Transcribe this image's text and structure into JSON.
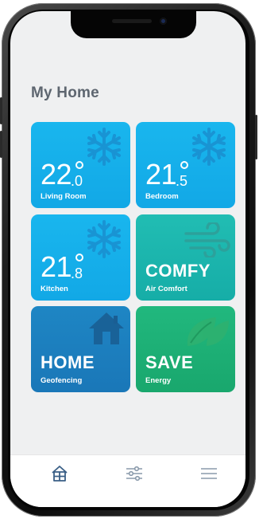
{
  "page": {
    "title": "My Home"
  },
  "tiles": [
    {
      "kind": "temperature",
      "whole": "22",
      "decimal": ".0",
      "label": "Living Room",
      "icon": "snowflake-icon",
      "color": "#19b6ee"
    },
    {
      "kind": "temperature",
      "whole": "21",
      "decimal": ".5",
      "label": "Bedroom",
      "icon": "snowflake-icon",
      "color": "#19b6ee"
    },
    {
      "kind": "temperature",
      "whole": "21",
      "decimal": ".8",
      "label": "Kitchen",
      "icon": "snowflake-icon",
      "color": "#19b6ee"
    },
    {
      "kind": "mode",
      "word": "COMFY",
      "label": "Air Comfort",
      "icon": "wind-icon",
      "color": "#21bdb3"
    },
    {
      "kind": "mode",
      "word": "HOME",
      "label": "Geofencing",
      "icon": "house-icon",
      "color": "#1e86c4"
    },
    {
      "kind": "mode",
      "word": "SAVE",
      "label": "Energy",
      "icon": "leaf-icon",
      "color": "#21b87e"
    }
  ],
  "tabbar": {
    "items": [
      {
        "icon": "home-icon",
        "active": true,
        "color": "#3a5f86"
      },
      {
        "icon": "sliders-icon",
        "active": false,
        "color": "#8a9aab"
      },
      {
        "icon": "menu-icon",
        "active": false,
        "color": "#8a9aab"
      }
    ]
  }
}
